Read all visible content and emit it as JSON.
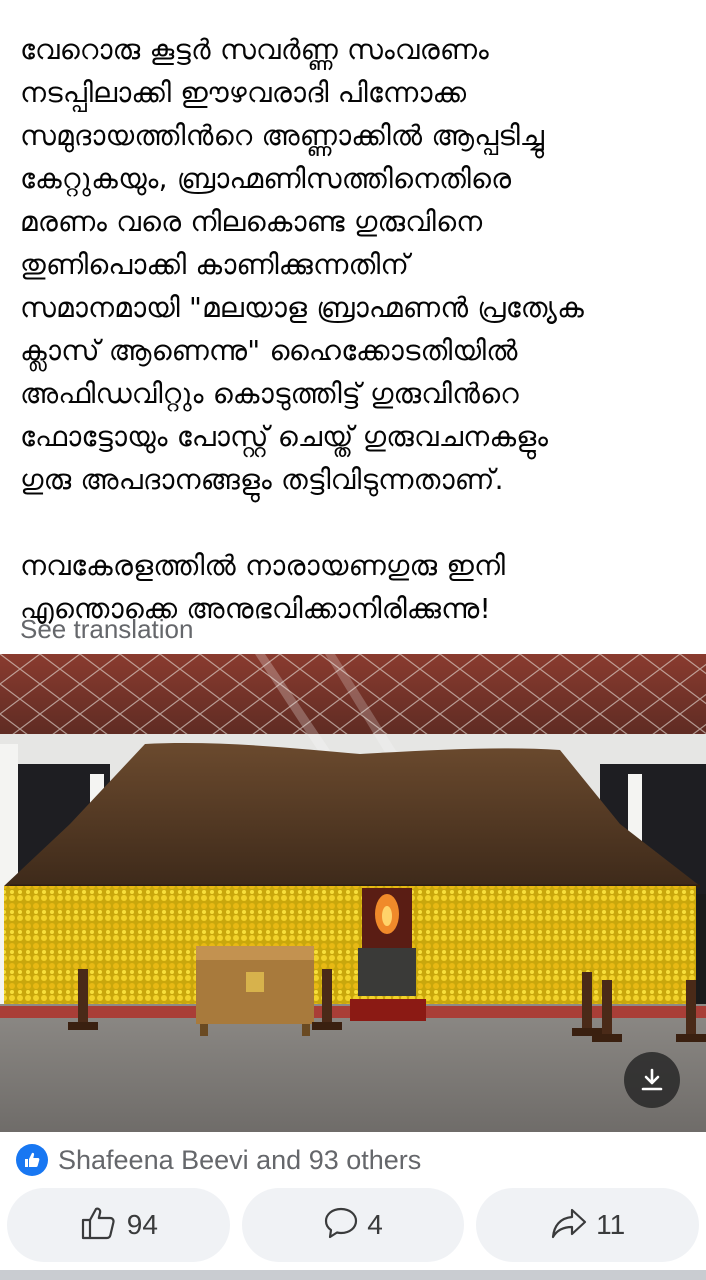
{
  "post": {
    "paragraph_1": "വേറൊരു കൂട്ടർ സവർണ്ണ സംവരണം\nനടപ്പിലാക്കി ഈഴവരാദി പിന്നോക്ക\nസമുദായത്തിൻറെ അണ്ണാക്കിൽ ആപ്പടിച്ചു\nകേറ്റുകയും, ബ്രാഹ്മണിസത്തിനെതിരെ\nമരണം വരെ നിലകൊണ്ട ഗുരുവിനെ\nതുണിപൊക്കി കാണിക്കുന്നതിന്\nസമാനമായി \"മലയാള ബ്രാഹ്മണൻ പ്രത്യേക\nക്ലാസ് ആണെന്നു\" ഹൈക്കോടതിയിൽ\nഅഫിഡവിറ്റും കൊടുത്തിട്ട് ഗുരുവിൻറെ\nഫോട്ടോയും പോസ്റ്റ് ചെയ്ത് ഗുരുവചനകളും\nഗുരു അപദാനങ്ങളും തട്ടിവിടുന്നതാണ്.",
    "paragraph_2": "നവകേരളത്തിൽ നാരായണഗുരു ഇനി\nഎന്തൊക്കെ അനുഭവിക്കാനിരിക്കുന്നു!",
    "see_translation": "See translation"
  },
  "photo": {
    "download_icon": "download-icon"
  },
  "reactions": {
    "icon": "like-icon",
    "text": "Shafeena Beevi and 93 others"
  },
  "actions": {
    "like_count": "94",
    "comment_count": "4",
    "share_count": "11"
  },
  "colors": {
    "accent": "#1877f2",
    "muted_text": "#65676b",
    "button_bg": "#f0f2f5"
  }
}
